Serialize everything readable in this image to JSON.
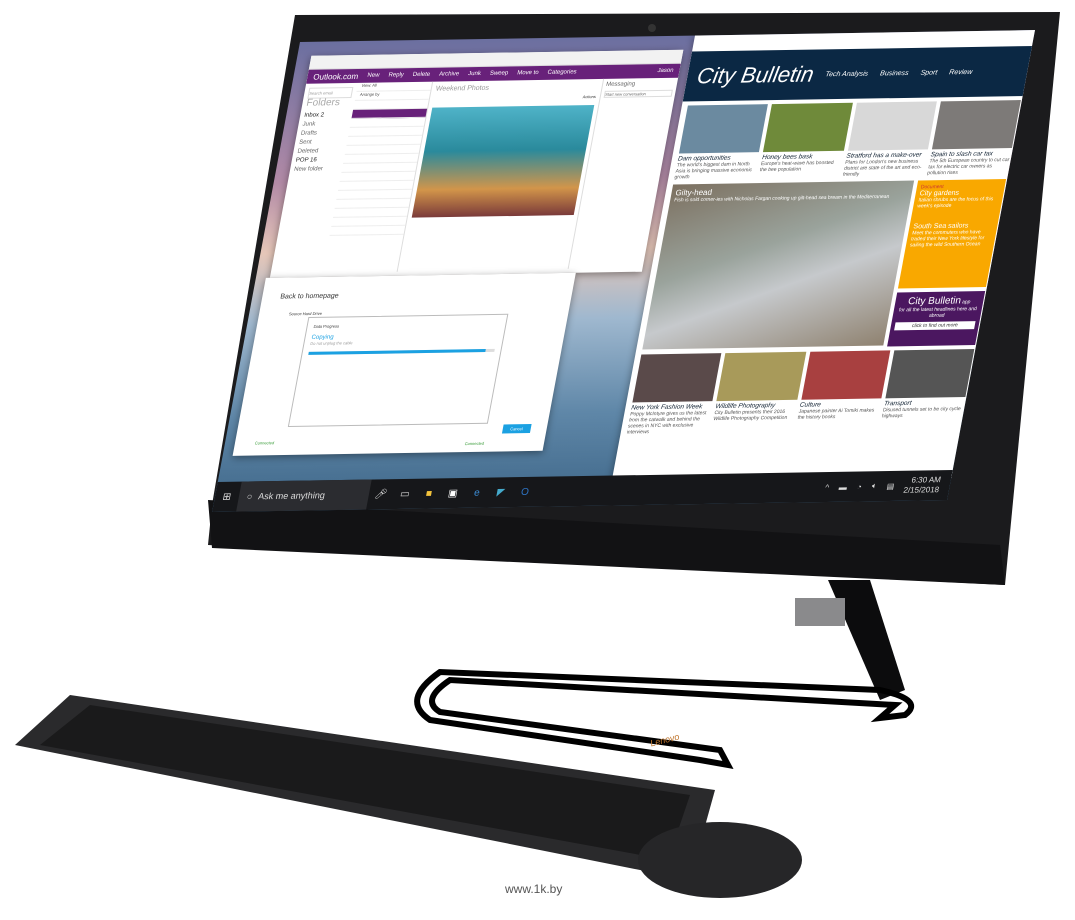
{
  "outlook": {
    "brand": "Outlook.com",
    "toolbar": [
      "New",
      "Reply",
      "Delete",
      "Archive",
      "Junk",
      "Sweep",
      "Move to",
      "Categories"
    ],
    "user": "Jason",
    "search_placeholder": "Search email",
    "folders_title": "Folders",
    "folders": [
      "Inbox 2",
      "Junk",
      "Drafts",
      "Sent",
      "Deleted",
      "POP 16",
      "New folder"
    ],
    "view": "View: All",
    "arrange": "Arrange by",
    "subject": "Weekend Photos",
    "actions": "Actions",
    "messaging_title": "Messaging",
    "messaging_placeholder": "Start new conversation"
  },
  "migration": {
    "back": "Back to homepage",
    "source": "Source Hard Drive",
    "dialog_title": "Data Progress",
    "status": "Copying",
    "substatus": "Do not unplug the cable",
    "status_left": "Connected",
    "status_right": "Connected",
    "cancel": "Cancel",
    "progress": 0.95
  },
  "bulletin": {
    "logo": "City Bulletin",
    "nav": [
      "Tech Analysis",
      "Business",
      "Sport",
      "Review"
    ],
    "top": [
      {
        "title": "Dam opportunities",
        "text": "The world's biggest dam in North Asia is bringing massive economic growth",
        "color": "#6b8aa0"
      },
      {
        "title": "Honey bees bask",
        "text": "Europe's heat-wave has boosted the bee population",
        "color": "#6f8a3a"
      },
      {
        "title": "Stratford has a make-over",
        "text": "Plans for London's new business district are state of the art and eco-friendly",
        "color": "#d8d8d8"
      },
      {
        "title": "Spain to slash car tax",
        "text": "The 5th European country to cut car tax for electric car owners as pollution rises",
        "color": "#7d7a78"
      }
    ],
    "feature": {
      "title": "Gilty-head",
      "text": "Fish is sold corner-ies with Nicholas Fargan cooking up gilt-head sea bream in the Mediterranean"
    },
    "doc": {
      "label": "Document",
      "h1": "City gardens",
      "t1": "Italian shrubs are the focus of this week's episode",
      "h2": "South Sea sailors",
      "t2": "Meet the commuters who have traded their New York lifestyle for sailing the wild Southern Ocean"
    },
    "app": {
      "title": "City Bulletin",
      "suffix": "app",
      "text": "for all the latest headlines here and abroad",
      "button": "click to find out more"
    },
    "bottom": [
      {
        "title": "New York Fashion Week",
        "text": "Poppy McIntyre gives us the latest from the catwalk and behind the scenes in NYC with exclusive interviews",
        "color": "#5a4a4a"
      },
      {
        "title": "Wildlife Photography",
        "text": "City Bulletin presents their 2016 Wildlife Photography Competition",
        "color": "#a89a5a"
      },
      {
        "title": "Culture",
        "text": "Japanese painter Ai Tomiki makes the history books",
        "color": "#a84040"
      },
      {
        "title": "Transport",
        "text": "Disused tunnels set to be city cycle highways",
        "color": "#555"
      }
    ]
  },
  "taskbar": {
    "search": "Ask me anything",
    "time": "6:30 AM",
    "date": "2/15/2018"
  },
  "colors": {
    "outlook": "#68217a",
    "bulletin_header": "#0b2844",
    "doc_tile": "#f9a800",
    "app_tile": "#4b1760",
    "accent": "#1ba1e2"
  },
  "product": {
    "brand": "Lenovo"
  },
  "watermark": "www.1k.by"
}
